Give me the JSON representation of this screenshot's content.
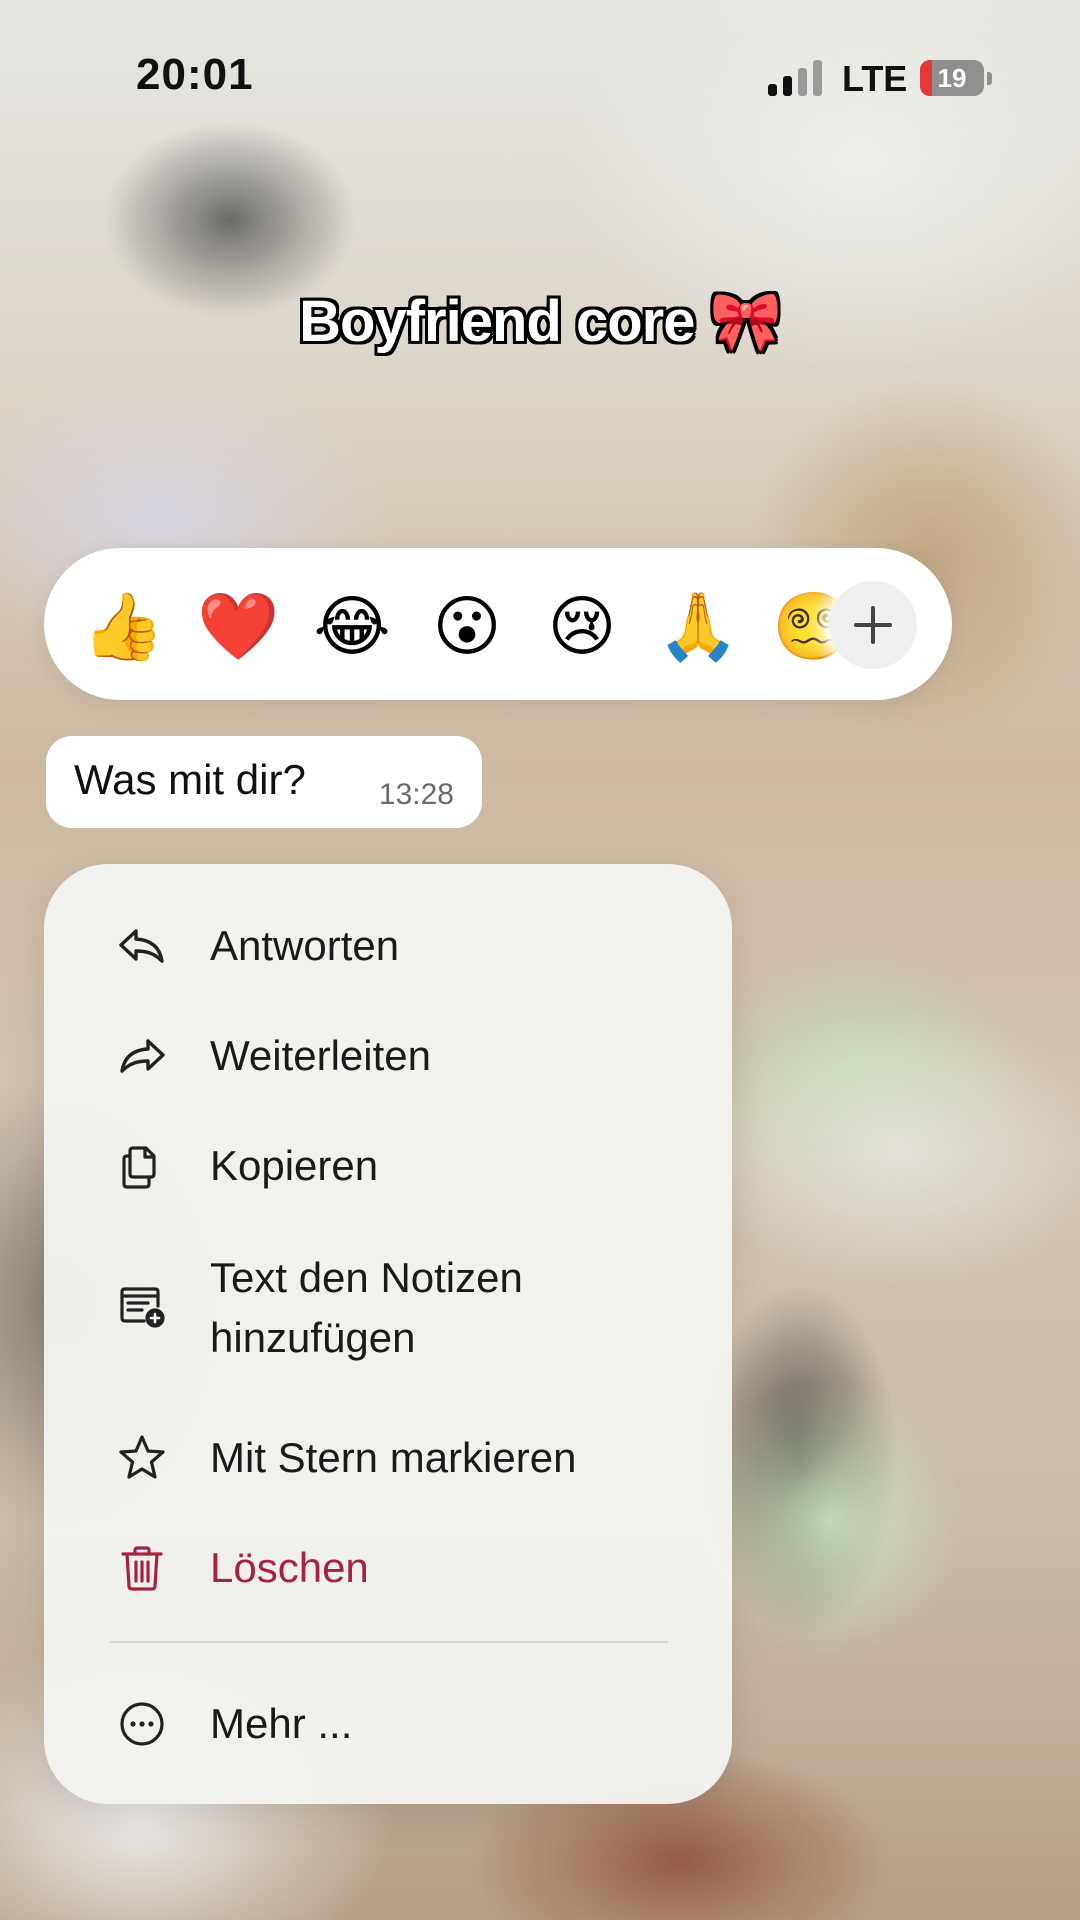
{
  "status_bar": {
    "time": "20:01",
    "network": "LTE",
    "battery_level": "19",
    "battery_fraction": 0.19,
    "signal_bars": 2
  },
  "caption": {
    "text": "Boyfriend core 🎀"
  },
  "reactions": {
    "items": [
      {
        "emoji": "👍",
        "icon": "thumbs-up"
      },
      {
        "emoji": "❤️",
        "icon": "red-heart"
      },
      {
        "emoji": "😂",
        "icon": "tears-of-joy"
      },
      {
        "emoji": "😮",
        "icon": "open-mouth"
      },
      {
        "emoji": "😢",
        "icon": "crying-face"
      },
      {
        "emoji": "🙏",
        "icon": "folded-hands"
      },
      {
        "emoji": "😵‍💫",
        "icon": "face-with-spiral-eyes"
      }
    ],
    "more_icon": "plus-icon"
  },
  "message": {
    "text": "Was mit dir?",
    "time": "13:28"
  },
  "menu": {
    "items": [
      {
        "label": "Antworten",
        "icon": "reply-icon"
      },
      {
        "label": "Weiterleiten",
        "icon": "forward-icon"
      },
      {
        "label": "Kopieren",
        "icon": "copy-icon"
      },
      {
        "label": "Text den Notizen",
        "label_line2": "hinzufügen",
        "icon": "add-to-notes-icon"
      },
      {
        "label": "Mit Stern markieren",
        "icon": "star-icon"
      },
      {
        "label": "Löschen",
        "icon": "trash-icon",
        "color": "#a5233f"
      },
      {
        "label": "Mehr ...",
        "icon": "more-icon"
      }
    ]
  },
  "colors": {
    "danger": "#a5233f",
    "battery_low": "#e5383b"
  }
}
